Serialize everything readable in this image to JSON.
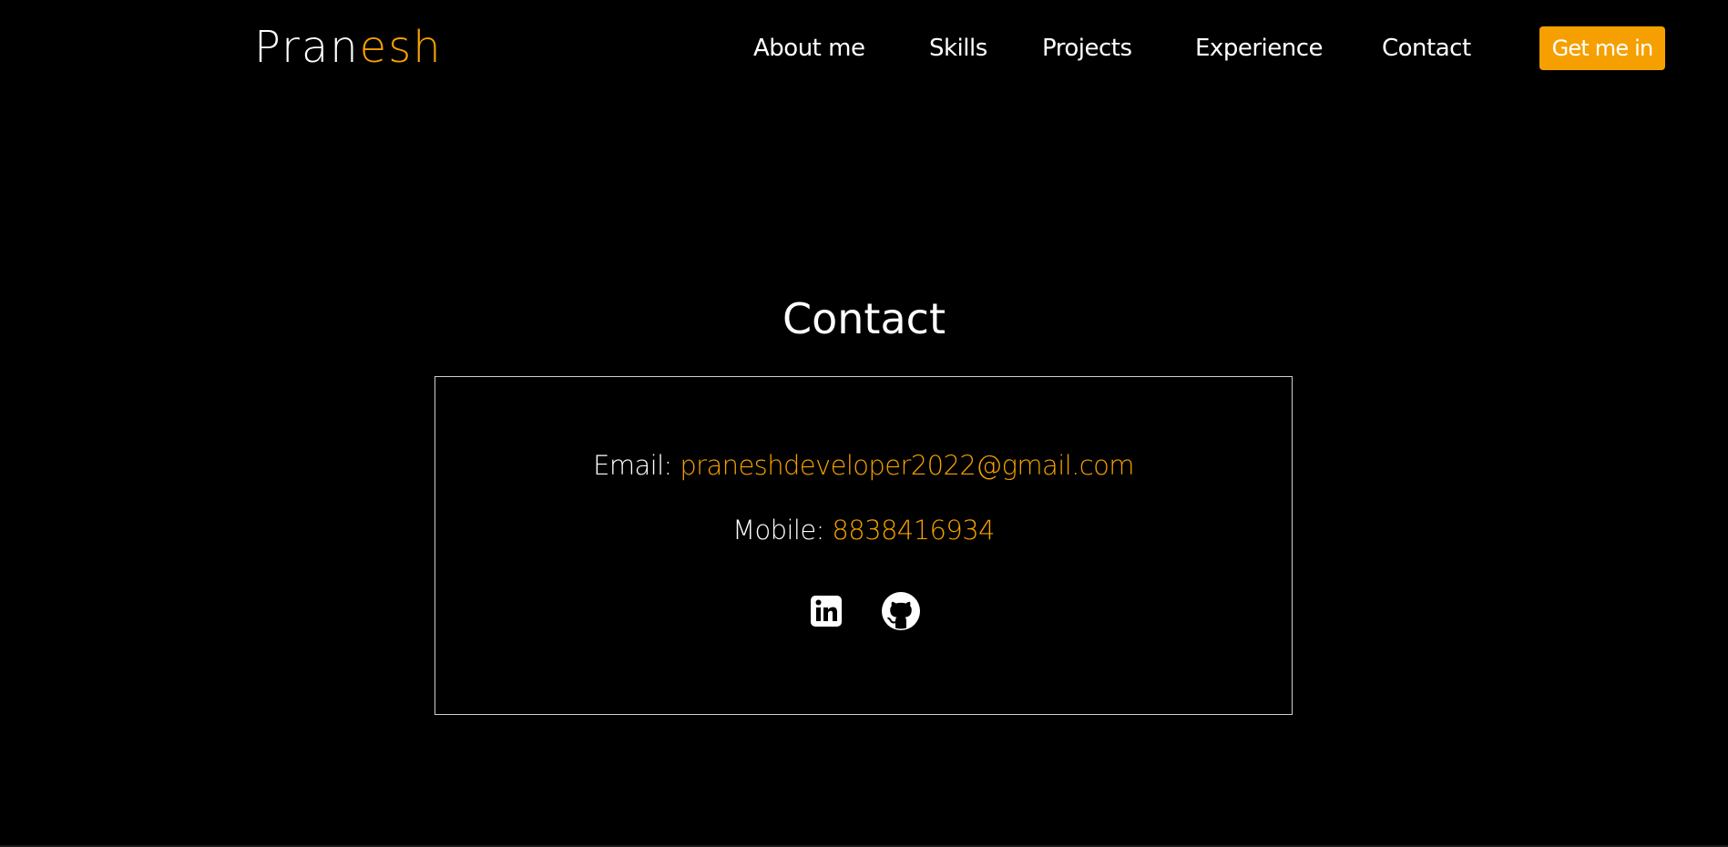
{
  "header": {
    "logo": {
      "part1": "Pran",
      "part2": "esh"
    },
    "nav": [
      {
        "label": "About me"
      },
      {
        "label": "Skills"
      },
      {
        "label": "Projects"
      },
      {
        "label": "Experience"
      },
      {
        "label": "Contact"
      }
    ],
    "cta_label": "Get me in"
  },
  "contact": {
    "title": "Contact",
    "email_label": "Email:",
    "email_value": "praneshdeveloper2022@gmail.com",
    "mobile_label": "Mobile:",
    "mobile_value": "8838416934",
    "socials": [
      {
        "icon": "linkedin-icon"
      },
      {
        "icon": "github-icon"
      }
    ]
  },
  "colors": {
    "background": "#000000",
    "accent": "#f5a000",
    "text": "#ffffff",
    "border": "#cfcfcf"
  }
}
